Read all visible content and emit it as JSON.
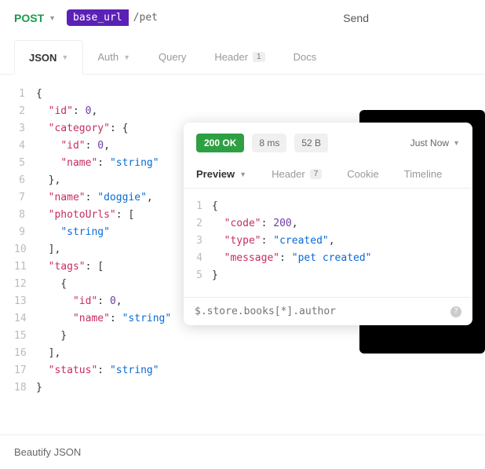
{
  "request": {
    "method": "POST",
    "base_url_label": "base_url",
    "path": "/pet",
    "send_label": "Send"
  },
  "req_tabs": {
    "json": "JSON",
    "auth": "Auth",
    "query": "Query",
    "header": "Header",
    "header_badge": "1",
    "docs": "Docs"
  },
  "request_body_lines": [
    {
      "n": "1",
      "segs": [
        {
          "c": "p",
          "t": "{"
        }
      ]
    },
    {
      "n": "2",
      "segs": [
        {
          "c": "p",
          "t": "  "
        },
        {
          "c": "k",
          "t": "\"id\""
        },
        {
          "c": "p",
          "t": ": "
        },
        {
          "c": "n",
          "t": "0"
        },
        {
          "c": "p",
          "t": ","
        }
      ]
    },
    {
      "n": "3",
      "segs": [
        {
          "c": "p",
          "t": "  "
        },
        {
          "c": "k",
          "t": "\"category\""
        },
        {
          "c": "p",
          "t": ": {"
        }
      ]
    },
    {
      "n": "4",
      "segs": [
        {
          "c": "p",
          "t": "    "
        },
        {
          "c": "k",
          "t": "\"id\""
        },
        {
          "c": "p",
          "t": ": "
        },
        {
          "c": "n",
          "t": "0"
        },
        {
          "c": "p",
          "t": ","
        }
      ]
    },
    {
      "n": "5",
      "segs": [
        {
          "c": "p",
          "t": "    "
        },
        {
          "c": "k",
          "t": "\"name\""
        },
        {
          "c": "p",
          "t": ": "
        },
        {
          "c": "s",
          "t": "\"string\""
        }
      ]
    },
    {
      "n": "6",
      "segs": [
        {
          "c": "p",
          "t": "  },"
        }
      ]
    },
    {
      "n": "7",
      "segs": [
        {
          "c": "p",
          "t": "  "
        },
        {
          "c": "k",
          "t": "\"name\""
        },
        {
          "c": "p",
          "t": ": "
        },
        {
          "c": "s",
          "t": "\"doggie\""
        },
        {
          "c": "p",
          "t": ","
        }
      ]
    },
    {
      "n": "8",
      "segs": [
        {
          "c": "p",
          "t": "  "
        },
        {
          "c": "k",
          "t": "\"photoUrls\""
        },
        {
          "c": "p",
          "t": ": ["
        }
      ]
    },
    {
      "n": "9",
      "segs": [
        {
          "c": "p",
          "t": "    "
        },
        {
          "c": "s",
          "t": "\"string\""
        }
      ]
    },
    {
      "n": "10",
      "segs": [
        {
          "c": "p",
          "t": "  ],"
        }
      ]
    },
    {
      "n": "11",
      "segs": [
        {
          "c": "p",
          "t": "  "
        },
        {
          "c": "k",
          "t": "\"tags\""
        },
        {
          "c": "p",
          "t": ": ["
        }
      ]
    },
    {
      "n": "12",
      "segs": [
        {
          "c": "p",
          "t": "    {"
        }
      ]
    },
    {
      "n": "13",
      "segs": [
        {
          "c": "p",
          "t": "      "
        },
        {
          "c": "k",
          "t": "\"id\""
        },
        {
          "c": "p",
          "t": ": "
        },
        {
          "c": "n",
          "t": "0"
        },
        {
          "c": "p",
          "t": ","
        }
      ]
    },
    {
      "n": "14",
      "segs": [
        {
          "c": "p",
          "t": "      "
        },
        {
          "c": "k",
          "t": "\"name\""
        },
        {
          "c": "p",
          "t": ": "
        },
        {
          "c": "s",
          "t": "\"string\""
        }
      ]
    },
    {
      "n": "15",
      "segs": [
        {
          "c": "p",
          "t": "    }"
        }
      ]
    },
    {
      "n": "16",
      "segs": [
        {
          "c": "p",
          "t": "  ],"
        }
      ]
    },
    {
      "n": "17",
      "segs": [
        {
          "c": "p",
          "t": "  "
        },
        {
          "c": "k",
          "t": "\"status\""
        },
        {
          "c": "p",
          "t": ": "
        },
        {
          "c": "s",
          "t": "\"string\""
        }
      ]
    },
    {
      "n": "18",
      "segs": [
        {
          "c": "p",
          "t": "}"
        }
      ]
    }
  ],
  "response": {
    "status_text": "200 OK",
    "time": "8 ms",
    "size": "52 B",
    "when": "Just Now",
    "tabs": {
      "preview": "Preview",
      "header": "Header",
      "header_badge": "7",
      "cookie": "Cookie",
      "timeline": "Timeline"
    },
    "body_lines": [
      {
        "n": "1",
        "segs": [
          {
            "c": "p",
            "t": "{"
          }
        ]
      },
      {
        "n": "2",
        "segs": [
          {
            "c": "p",
            "t": "  "
          },
          {
            "c": "k",
            "t": "\"code\""
          },
          {
            "c": "p",
            "t": ": "
          },
          {
            "c": "n",
            "t": "200"
          },
          {
            "c": "p",
            "t": ","
          }
        ]
      },
      {
        "n": "3",
        "segs": [
          {
            "c": "p",
            "t": "  "
          },
          {
            "c": "k",
            "t": "\"type\""
          },
          {
            "c": "p",
            "t": ": "
          },
          {
            "c": "s",
            "t": "\"created\""
          },
          {
            "c": "p",
            "t": ","
          }
        ]
      },
      {
        "n": "4",
        "segs": [
          {
            "c": "p",
            "t": "  "
          },
          {
            "c": "k",
            "t": "\"message\""
          },
          {
            "c": "p",
            "t": ": "
          },
          {
            "c": "s",
            "t": "\"pet created\""
          }
        ]
      },
      {
        "n": "5",
        "segs": [
          {
            "c": "p",
            "t": "}"
          }
        ]
      }
    ],
    "filter_placeholder": "$.store.books[*].author"
  },
  "bottom": {
    "beautify": "Beautify JSON"
  }
}
